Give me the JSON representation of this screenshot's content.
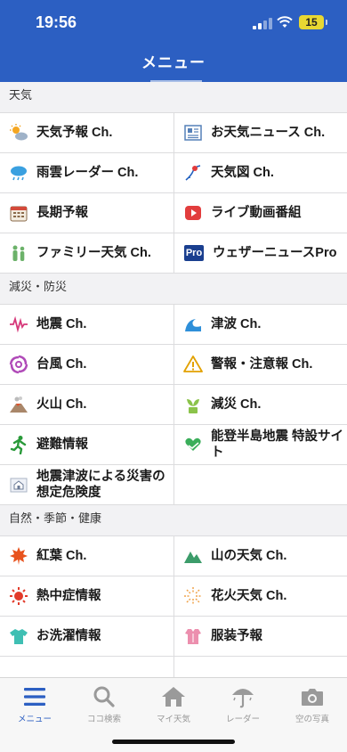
{
  "status_bar": {
    "time": "19:56",
    "battery": "15"
  },
  "header": {
    "title": "メニュー"
  },
  "sections": [
    {
      "title": "天気",
      "items": [
        {
          "label": "天気予報 Ch.",
          "icon": "sun-cloud-icon"
        },
        {
          "label": "お天気ニュース Ch.",
          "icon": "newspaper-icon"
        },
        {
          "label": "雨雲レーダー Ch.",
          "icon": "rain-cloud-icon"
        },
        {
          "label": "天気図 Ch.",
          "icon": "weather-map-icon"
        },
        {
          "label": "長期予報",
          "icon": "calendar-icon"
        },
        {
          "label": "ライブ動画番組",
          "icon": "play-icon"
        },
        {
          "label": "ファミリー天気 Ch.",
          "icon": "family-icon"
        },
        {
          "label": "ウェザーニュースPro",
          "icon": "pro-badge-icon",
          "badge": "Pro"
        }
      ]
    },
    {
      "title": "減災・防災",
      "items": [
        {
          "label": "地震 Ch.",
          "icon": "seismograph-icon"
        },
        {
          "label": "津波 Ch.",
          "icon": "wave-icon"
        },
        {
          "label": "台風 Ch.",
          "icon": "typhoon-icon"
        },
        {
          "label": "警報・注意報 Ch.",
          "icon": "warning-icon"
        },
        {
          "label": "火山 Ch.",
          "icon": "volcano-icon"
        },
        {
          "label": "減災 Ch.",
          "icon": "sprout-icon"
        },
        {
          "label": "避難情報",
          "icon": "evacuation-icon"
        },
        {
          "label": "能登半島地震 特設サイト",
          "icon": "heart-hands-icon"
        },
        {
          "label": "地震津波による災害の想定危険度",
          "icon": "house-hazard-icon"
        },
        {
          "label": "",
          "icon": ""
        }
      ]
    },
    {
      "title": "自然・季節・健康",
      "items": [
        {
          "label": "紅葉 Ch.",
          "icon": "maple-leaf-icon"
        },
        {
          "label": "山の天気 Ch.",
          "icon": "mountain-icon"
        },
        {
          "label": "熱中症情報",
          "icon": "hot-sun-icon"
        },
        {
          "label": "花火天気 Ch.",
          "icon": "fireworks-icon"
        },
        {
          "label": "お洗濯情報",
          "icon": "shirt-icon"
        },
        {
          "label": "服装予報",
          "icon": "clothes-icon"
        }
      ]
    }
  ],
  "tabbar": [
    {
      "label": "メニュー",
      "icon": "menu-icon",
      "active": true
    },
    {
      "label": "ココ検索",
      "icon": "search-icon",
      "active": false
    },
    {
      "label": "マイ天気",
      "icon": "home-icon",
      "active": false
    },
    {
      "label": "レーダー",
      "icon": "umbrella-icon",
      "active": false
    },
    {
      "label": "空の写真",
      "icon": "camera-icon",
      "active": false
    }
  ],
  "colors": {
    "header_bg": "#2c5fc2",
    "active_tab": "#2c5fc2",
    "inactive_tab": "#999999"
  }
}
